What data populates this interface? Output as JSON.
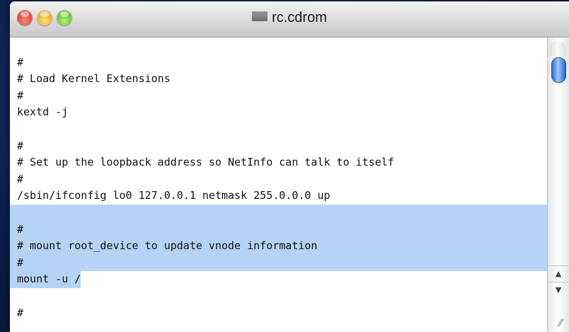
{
  "window": {
    "title": "rc.cdrom"
  },
  "editor": {
    "lines": [
      "",
      "#",
      "# Load Kernel Extensions",
      "#",
      "kextd -j",
      "",
      "#",
      "# Set up the loopback address so NetInfo can talk to itself",
      "#",
      "/sbin/ifconfig lo0 127.0.0.1 netmask 255.0.0.0 up",
      "",
      "#",
      "# mount root_device to update vnode information",
      "#",
      "mount -u /",
      "",
      "#"
    ],
    "selected_lines": [
      10,
      11,
      12,
      13
    ],
    "partial_selected_line": 14
  },
  "scrollbar": {
    "up_arrow": "▲",
    "down_arrow": "▼",
    "grow_glyph": "⁄⁄"
  },
  "colors": {
    "selection": "#b5d4f5",
    "desktop": "#0d2150"
  }
}
